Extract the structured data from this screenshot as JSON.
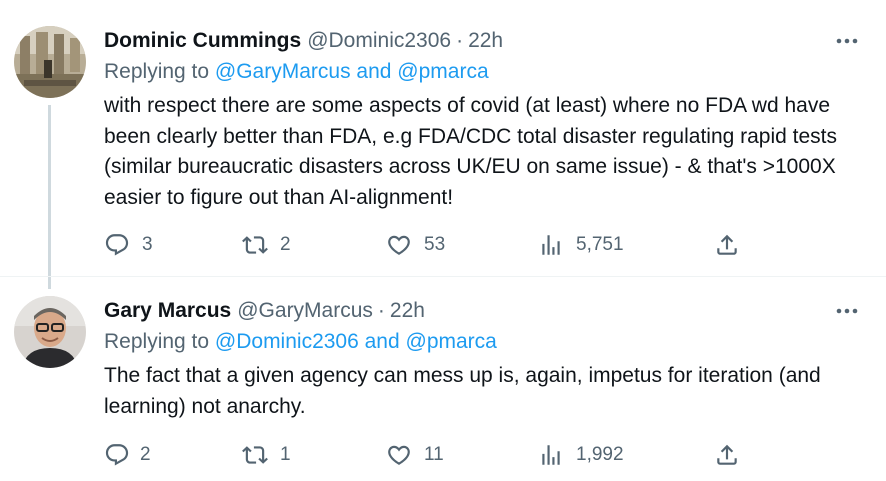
{
  "tweets": [
    {
      "author_name": "Dominic Cummings",
      "handle": "@Dominic2306",
      "separator": "·",
      "time": "22h",
      "replying_prefix": "Replying to",
      "replying_mentions": "@GaryMarcus and @pmarca",
      "text": "with respect there are some aspects of covid (at least) where no FDA wd have been clearly better than FDA, e.g FDA/CDC total disaster regulating rapid tests (similar bureaucratic disasters across UK/EU on same issue) - & that's >1000X easier to figure out than AI-alignment!",
      "replies": "3",
      "retweets": "2",
      "likes": "53",
      "views": "5,751"
    },
    {
      "author_name": "Gary Marcus",
      "handle": "@GaryMarcus",
      "separator": "·",
      "time": "22h",
      "replying_prefix": "Replying to",
      "replying_mentions": "@Dominic2306 and @pmarca",
      "text": "The fact that a given agency can mess up is, again, impetus for iteration (and learning) not anarchy.",
      "replies": "2",
      "retweets": "1",
      "likes": "11",
      "views": "1,992"
    }
  ],
  "icons": {
    "reply": "reply-bubble-icon",
    "retweet": "retweet-arrows-icon",
    "like": "heart-icon",
    "views": "analytics-bars-icon",
    "share": "share-upload-icon",
    "more": "more-dots-icon"
  },
  "colors": {
    "link": "#1d9bf0",
    "secondary_text": "#536471",
    "primary_text": "#0f1419",
    "thread_line": "#cfd9de"
  }
}
